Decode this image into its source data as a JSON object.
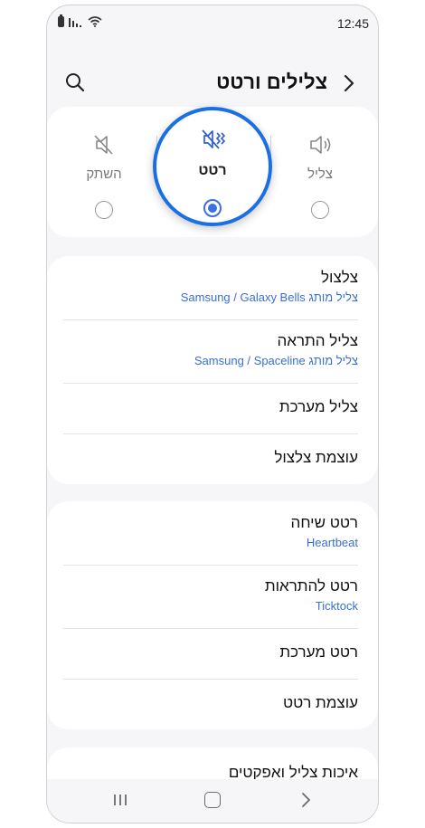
{
  "status": {
    "time": "12:45"
  },
  "header": {
    "title": "צלילים ורטט"
  },
  "modes": [
    {
      "label": "צליל",
      "selected": false
    },
    {
      "label": "רטט",
      "selected": true
    },
    {
      "label": "השתק",
      "selected": false
    }
  ],
  "sound_section": {
    "ringtone": {
      "title": "צלצול",
      "subtitle": "צליל מותג Samsung / Galaxy Bells"
    },
    "notification_sound": {
      "title": "צליל התראה",
      "subtitle": "צליל מותג Samsung / Spaceline"
    },
    "system_sound": {
      "title": "צליל מערכת"
    },
    "ring_volume": {
      "title": "עוצמת צלצול"
    }
  },
  "vibration_section": {
    "call_vibration": {
      "title": "רטט שיחה",
      "subtitle": "Heartbeat"
    },
    "notification_vibration": {
      "title": "רטט להתראות",
      "subtitle": "Ticktock"
    },
    "system_vibration": {
      "title": "רטט מערכת"
    },
    "vibration_intensity": {
      "title": "עוצמת רטט"
    }
  },
  "quality_section": {
    "title": "איכות צליל ואפקטים"
  },
  "colors": {
    "accent": "#3b6fe2",
    "highlight_ring": "#1a6fe6",
    "subtitle": "#3a6fd0"
  }
}
